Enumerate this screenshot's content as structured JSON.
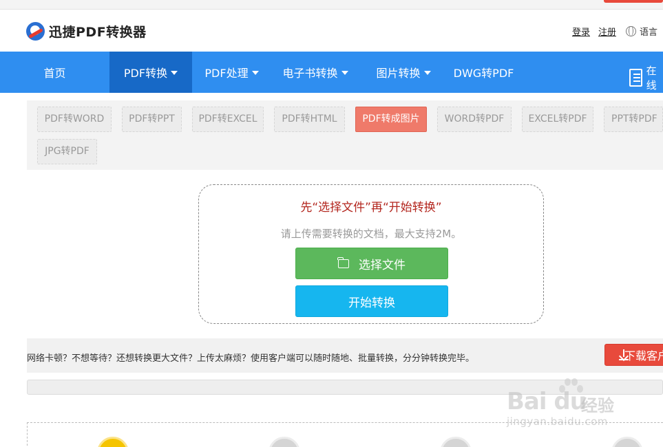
{
  "header": {
    "logo_text": "迅捷PDF转换器",
    "login": "登录",
    "register": "注册",
    "language": "语言"
  },
  "nav": {
    "items": [
      {
        "label": "首页"
      },
      {
        "label": "PDF转换"
      },
      {
        "label": "PDF处理"
      },
      {
        "label": "电子书转换"
      },
      {
        "label": "图片转换"
      },
      {
        "label": "DWG转PDF"
      }
    ],
    "right_label": "在线"
  },
  "subnav": {
    "items": [
      {
        "label": "PDF转WORD"
      },
      {
        "label": "PDF转PPT"
      },
      {
        "label": "PDF转EXCEL"
      },
      {
        "label": "PDF转HTML"
      },
      {
        "label": "PDF转成图片"
      },
      {
        "label": "WORD转PDF"
      },
      {
        "label": "EXCEL转PDF"
      },
      {
        "label": "PPT转PDF"
      },
      {
        "label": "JPG转PDF"
      }
    ]
  },
  "upload": {
    "title": "先“选择文件”再“开始转换”",
    "hint": "请上传需要转换的文档，最大支持2M。",
    "choose_label": "选择文件",
    "start_label": "开始转换"
  },
  "promo": {
    "text": "网络卡顿？不想等待？还想转换更大文件？上传太麻烦？使用客户端可以随时随地、批量转换，分分钟转换完毕。",
    "download_label": "下载客户端"
  },
  "progress": {
    "percent": 0
  },
  "watermark": {
    "brand": "Bai du",
    "brand_cn": "经验",
    "url": "jingyan.baidu.com"
  },
  "colors": {
    "nav_bg": "#2f8ef0",
    "nav_active": "#1769c7",
    "chip_active": "#ef7a6a",
    "choose_btn": "#5cb85c",
    "start_btn": "#16b6ef",
    "download_btn": "#e84a3c",
    "title_red": "#b3261e"
  }
}
